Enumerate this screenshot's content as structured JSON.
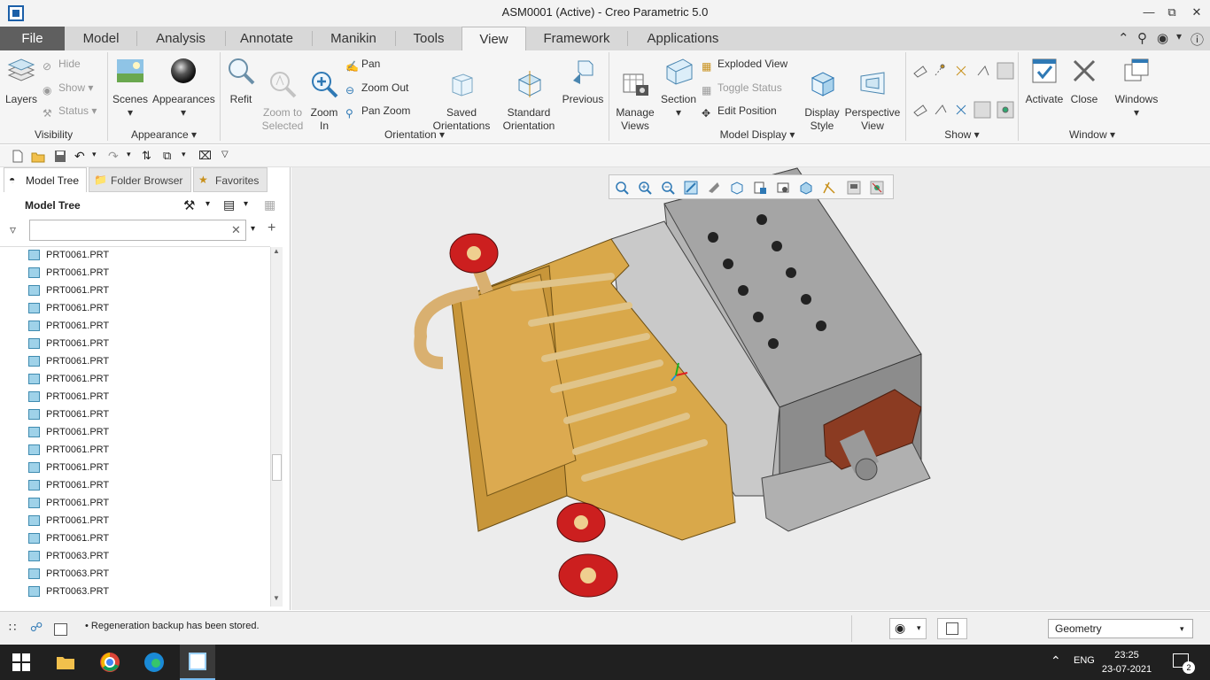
{
  "window": {
    "title": "ASM0001 (Active) - Creo Parametric 5.0"
  },
  "tabs": [
    {
      "label": "File"
    },
    {
      "label": "Model"
    },
    {
      "label": "Analysis"
    },
    {
      "label": "Annotate"
    },
    {
      "label": "Manikin"
    },
    {
      "label": "Tools"
    },
    {
      "label": "View"
    },
    {
      "label": "Framework"
    },
    {
      "label": "Applications"
    }
  ],
  "ribbon": {
    "visibility": {
      "layers": "Layers",
      "hide": "Hide",
      "show": "Show",
      "status": "Status",
      "group_label": "Visibility"
    },
    "appearance": {
      "scenes": "Scenes",
      "appearances": "Appearances",
      "group_label": "Appearance"
    },
    "orientation": {
      "refit": "Refit",
      "zoom_to_selected": "Zoom to\nSelected",
      "zoom_in": "Zoom\nIn",
      "pan": "Pan",
      "zoom_out": "Zoom Out",
      "pan_zoom": "Pan Zoom",
      "saved_orientations": "Saved\nOrientations",
      "standard_orientation": "Standard\nOrientation",
      "previous": "Previous",
      "group_label": "Orientation"
    },
    "model_display": {
      "manage_views": "Manage\nViews",
      "section": "Section",
      "exploded_view": "Exploded View",
      "toggle_status": "Toggle Status",
      "edit_position": "Edit Position",
      "display_style": "Display\nStyle",
      "perspective_view": "Perspective\nView",
      "group_label": "Model Display"
    },
    "show": {
      "group_label": "Show"
    },
    "window": {
      "activate": "Activate",
      "close": "Close",
      "windows": "Windows",
      "group_label": "Window"
    }
  },
  "left_panel": {
    "tabs": [
      {
        "label": "Model Tree"
      },
      {
        "label": "Folder Browser"
      },
      {
        "label": "Favorites"
      }
    ],
    "tree_title": "Model Tree",
    "filter_placeholder": "",
    "rows": [
      {
        "label": "PRT0061.PRT"
      },
      {
        "label": "PRT0061.PRT"
      },
      {
        "label": "PRT0061.PRT"
      },
      {
        "label": "PRT0061.PRT"
      },
      {
        "label": "PRT0061.PRT"
      },
      {
        "label": "PRT0061.PRT"
      },
      {
        "label": "PRT0061.PRT"
      },
      {
        "label": "PRT0061.PRT"
      },
      {
        "label": "PRT0061.PRT"
      },
      {
        "label": "PRT0061.PRT"
      },
      {
        "label": "PRT0061.PRT"
      },
      {
        "label": "PRT0061.PRT"
      },
      {
        "label": "PRT0061.PRT"
      },
      {
        "label": "PRT0061.PRT"
      },
      {
        "label": "PRT0061.PRT"
      },
      {
        "label": "PRT0061.PRT"
      },
      {
        "label": "PRT0061.PRT"
      },
      {
        "label": "PRT0063.PRT"
      },
      {
        "label": "PRT0063.PRT"
      },
      {
        "label": "PRT0063.PRT"
      }
    ]
  },
  "status": {
    "message": "Regeneration backup has been stored.",
    "filter_value": "Geometry"
  },
  "taskbar": {
    "language": "ENG",
    "time": "23:25",
    "date": "23-07-2021",
    "notifications": "2"
  },
  "colors": {
    "file_tab": "#5f5f5f",
    "model_gold": "#d9a84a",
    "flange_red": "#cc1f1f",
    "steel": "#9a9a9a"
  }
}
